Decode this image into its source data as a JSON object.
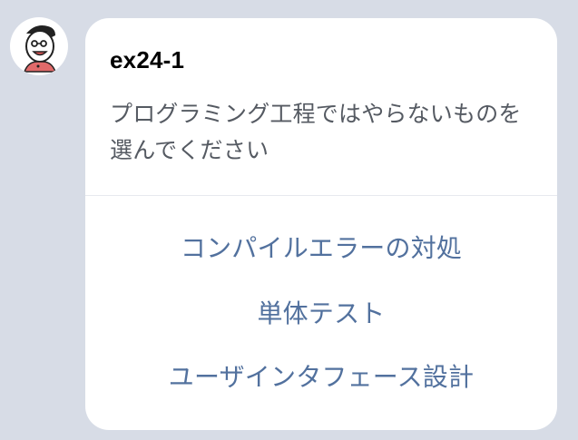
{
  "message": {
    "avatar_icon": "cartoon-character-avatar",
    "title": "ex24-1",
    "question": "プログラミング工程ではやらないものを選んでください",
    "options": [
      {
        "label": "コンパイルエラーの対処"
      },
      {
        "label": "単体テスト"
      },
      {
        "label": "ユーザインタフェース設計"
      }
    ]
  },
  "colors": {
    "background": "#d7dce6",
    "card": "#ffffff",
    "option_text": "#52719e",
    "question_text": "#555a62"
  }
}
